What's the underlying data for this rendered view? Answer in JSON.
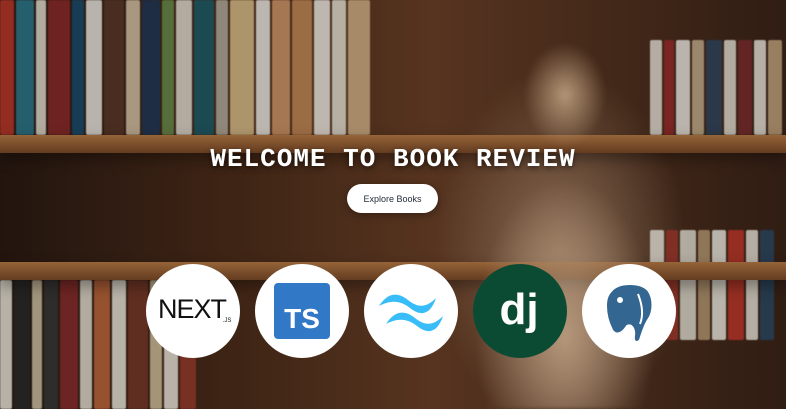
{
  "hero": {
    "title": "WELCOME TO BOOK REVIEW",
    "explore_label": "Explore Books"
  },
  "tech_logos": [
    {
      "icon": "nextjs-logo-icon"
    },
    {
      "icon": "typescript-logo-icon",
      "text": "TS",
      "color": "#3178c6"
    },
    {
      "icon": "tailwind-logo-icon",
      "color": "#38bdf8"
    },
    {
      "icon": "django-logo-icon",
      "text": "dj",
      "color": "#0c4b33"
    },
    {
      "icon": "postgresql-logo-icon",
      "color": "#336791"
    }
  ],
  "colors": {
    "button_bg": "#ffffff",
    "title_text": "#ffffff"
  }
}
